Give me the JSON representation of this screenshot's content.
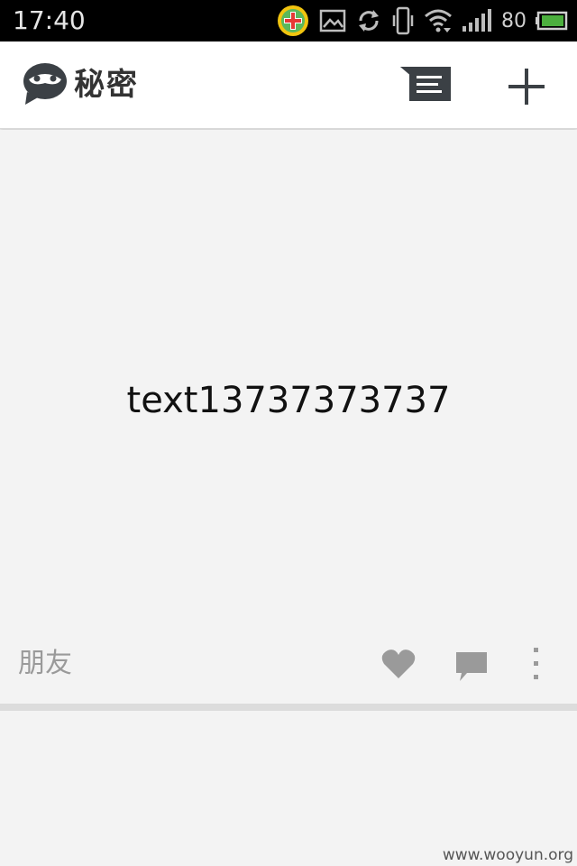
{
  "status_bar": {
    "time": "17:40",
    "battery_level": "80",
    "icons": [
      "app-plus-icon",
      "image-icon",
      "sync-icon",
      "vibrate-icon",
      "wifi-icon",
      "signal-icon",
      "battery-icon"
    ],
    "battery_color": "#4caf3e"
  },
  "app_bar": {
    "title": "秘密",
    "logo_icon": "mask-chat-logo-icon",
    "actions": [
      "messages-icon",
      "add-icon"
    ]
  },
  "post": {
    "text": "text13737373737",
    "label": "朋友",
    "actions": [
      "heart-icon",
      "comment-icon",
      "more-vertical-icon"
    ]
  },
  "watermark": "www.wooyun.org",
  "colors": {
    "app_bar_bg": "#ffffff",
    "card_bg": "#f3f3f3",
    "icon_dark": "#3b4045",
    "icon_gray": "#9a9a9a"
  }
}
